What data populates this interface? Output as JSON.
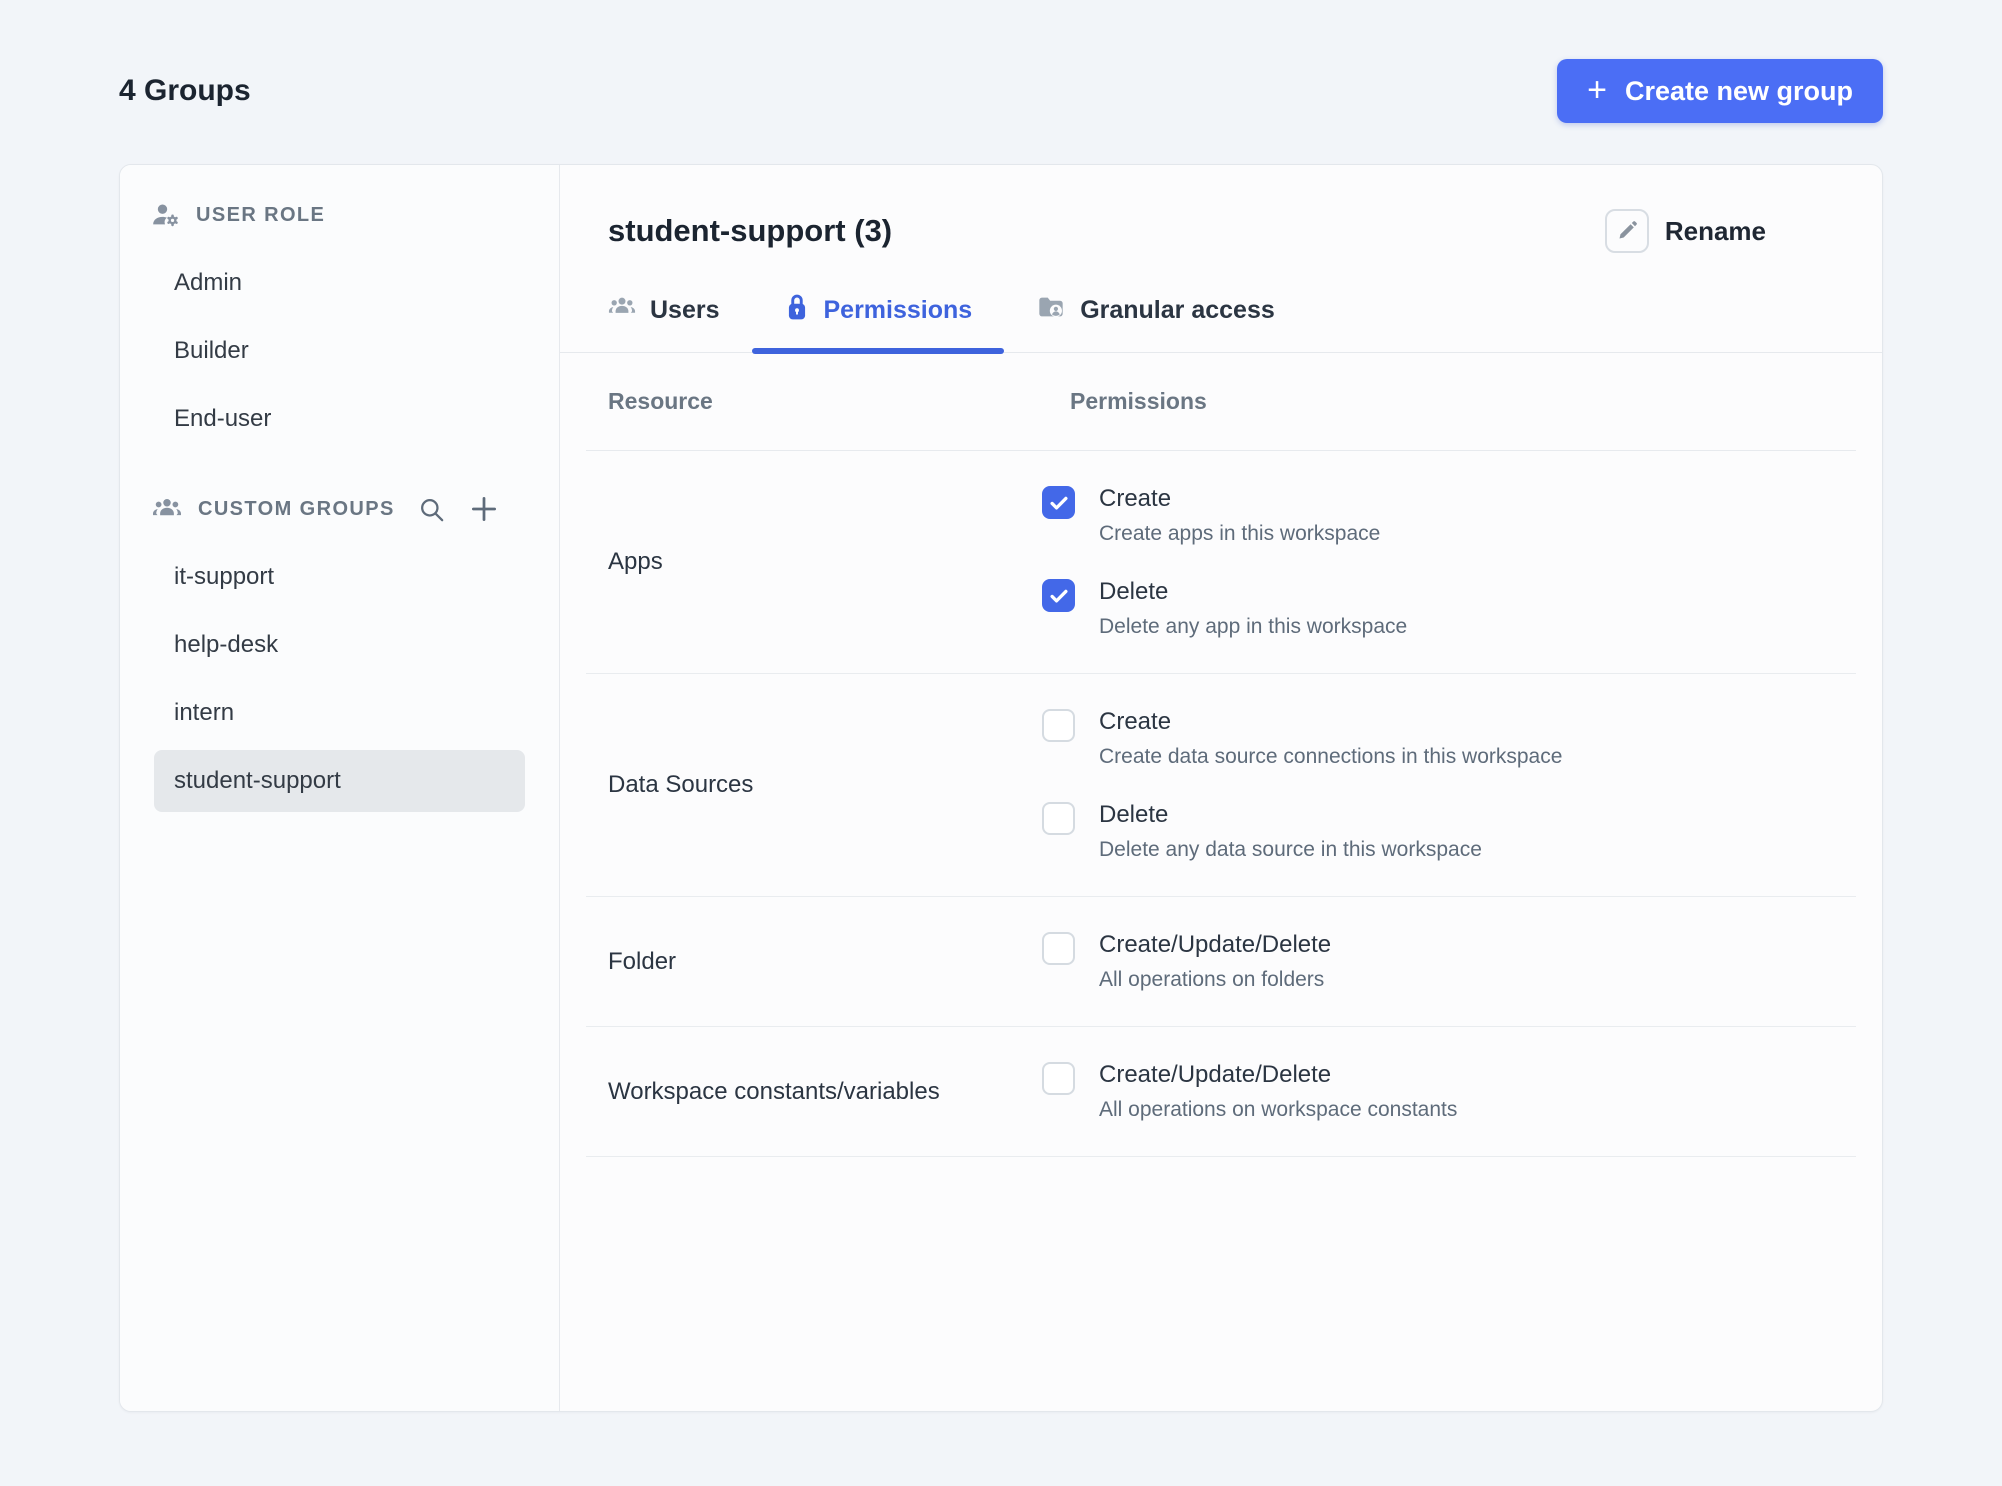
{
  "page": {
    "title": "4 Groups"
  },
  "header": {
    "create_button_label": "Create new group",
    "plus_glyph": "+"
  },
  "sidebar": {
    "user_role": {
      "label": "USER ROLE",
      "icon": "user-gear-icon",
      "items": [
        "Admin",
        "Builder",
        "End-user"
      ]
    },
    "custom_groups": {
      "label": "CUSTOM GROUPS",
      "icon": "people-group-icon",
      "actions": [
        "search-icon",
        "plus-icon"
      ],
      "items": [
        "it-support",
        "help-desk",
        "intern",
        "student-support"
      ],
      "selected": "student-support"
    }
  },
  "main": {
    "title": "student-support (3)",
    "rename_label": "Rename",
    "tabs": [
      {
        "label": "Users",
        "icon": "users-icon",
        "active": false
      },
      {
        "label": "Permissions",
        "icon": "lock-icon",
        "active": true
      },
      {
        "label": "Granular access",
        "icon": "folder-user-icon",
        "active": false
      }
    ],
    "table": {
      "columns": [
        "Resource",
        "Permissions"
      ],
      "rows": [
        {
          "resource": "Apps",
          "permissions": [
            {
              "label": "Create",
              "desc": "Create apps in this workspace",
              "checked": true
            },
            {
              "label": "Delete",
              "desc": "Delete any app in this workspace",
              "checked": true
            }
          ]
        },
        {
          "resource": "Data Sources",
          "permissions": [
            {
              "label": "Create",
              "desc": "Create data source connections in this workspace",
              "checked": false
            },
            {
              "label": "Delete",
              "desc": "Delete any data source in this workspace",
              "checked": false
            }
          ]
        },
        {
          "resource": "Folder",
          "permissions": [
            {
              "label": "Create/Update/Delete",
              "desc": "All operations on folders",
              "checked": false
            }
          ]
        },
        {
          "resource": "Workspace constants/variables",
          "permissions": [
            {
              "label": "Create/Update/Delete",
              "desc": "All operations on workspace constants",
              "checked": false
            }
          ]
        }
      ]
    }
  },
  "colors": {
    "accent": "#4B6EF5",
    "tab_active": "#3E63DD",
    "checkbox_checked": "#4368E8",
    "page_bg": "#F2F5F9",
    "selected_item_bg": "#E5E8EB"
  }
}
